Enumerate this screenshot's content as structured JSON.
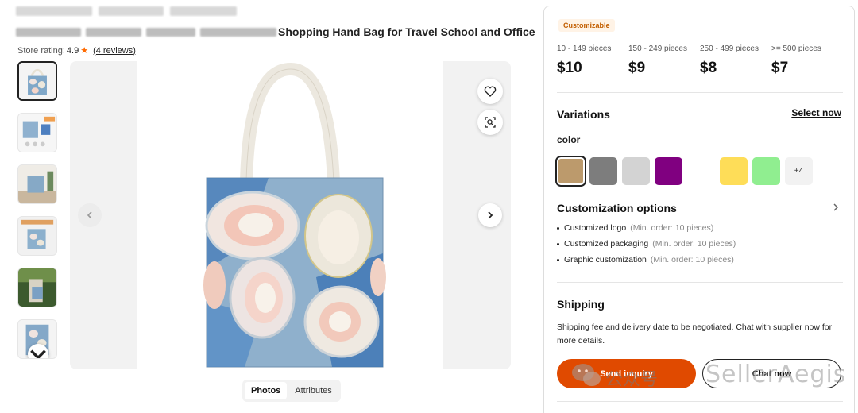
{
  "product": {
    "title_visible": "Shopping Hand Bag for Travel School and Office",
    "rating_label": "Store rating:",
    "rating_score": "4.9",
    "reviews_link": "(4 reviews)"
  },
  "gallery": {
    "thumbnail_count": 6,
    "active_thumbnail": 1,
    "tabs": [
      {
        "label": "Photos",
        "active": true
      },
      {
        "label": "Attributes",
        "active": false
      }
    ]
  },
  "pricing": {
    "badge": "Customizable",
    "tiers": [
      {
        "qty": "10 - 149 pieces",
        "price": "$10"
      },
      {
        "qty": "150 - 249 pieces",
        "price": "$9"
      },
      {
        "qty": "250 - 499 pieces",
        "price": "$8"
      },
      {
        "qty": ">= 500 pieces",
        "price": "$7"
      }
    ]
  },
  "variations": {
    "title": "Variations",
    "select_now": "Select now",
    "color_label": "color",
    "swatches": [
      {
        "color": "#bc9a6c",
        "selected": true
      },
      {
        "color": "#7d7d7d",
        "selected": false
      },
      {
        "color": "#d3d3d3",
        "selected": false
      },
      {
        "color": "#800080",
        "selected": false
      },
      {
        "color": "#ffffff",
        "selected": false
      },
      {
        "color": "#fedd58",
        "selected": false
      },
      {
        "color": "#90ee90",
        "selected": false
      }
    ],
    "more_label": "+4"
  },
  "customization": {
    "title": "Customization options",
    "options": [
      {
        "label": "Customized logo",
        "note": "(Min. order: 10 pieces)"
      },
      {
        "label": "Customized packaging",
        "note": "(Min. order: 10 pieces)"
      },
      {
        "label": "Graphic customization",
        "note": "(Min. order: 10 pieces)"
      }
    ]
  },
  "shipping": {
    "title": "Shipping",
    "text": "Shipping fee and delivery date to be negotiated. Chat with supplier now for more details."
  },
  "actions": {
    "send_inquiry": "Send inquiry",
    "chat_now": "Chat now"
  },
  "watermark": {
    "text_cn": "公众号",
    "text_en": "SellerAegis"
  },
  "colors": {
    "accent": "#e04a00",
    "star": "#ff6a00",
    "badge_bg": "#fff3e6",
    "badge_text": "#c25e00"
  }
}
